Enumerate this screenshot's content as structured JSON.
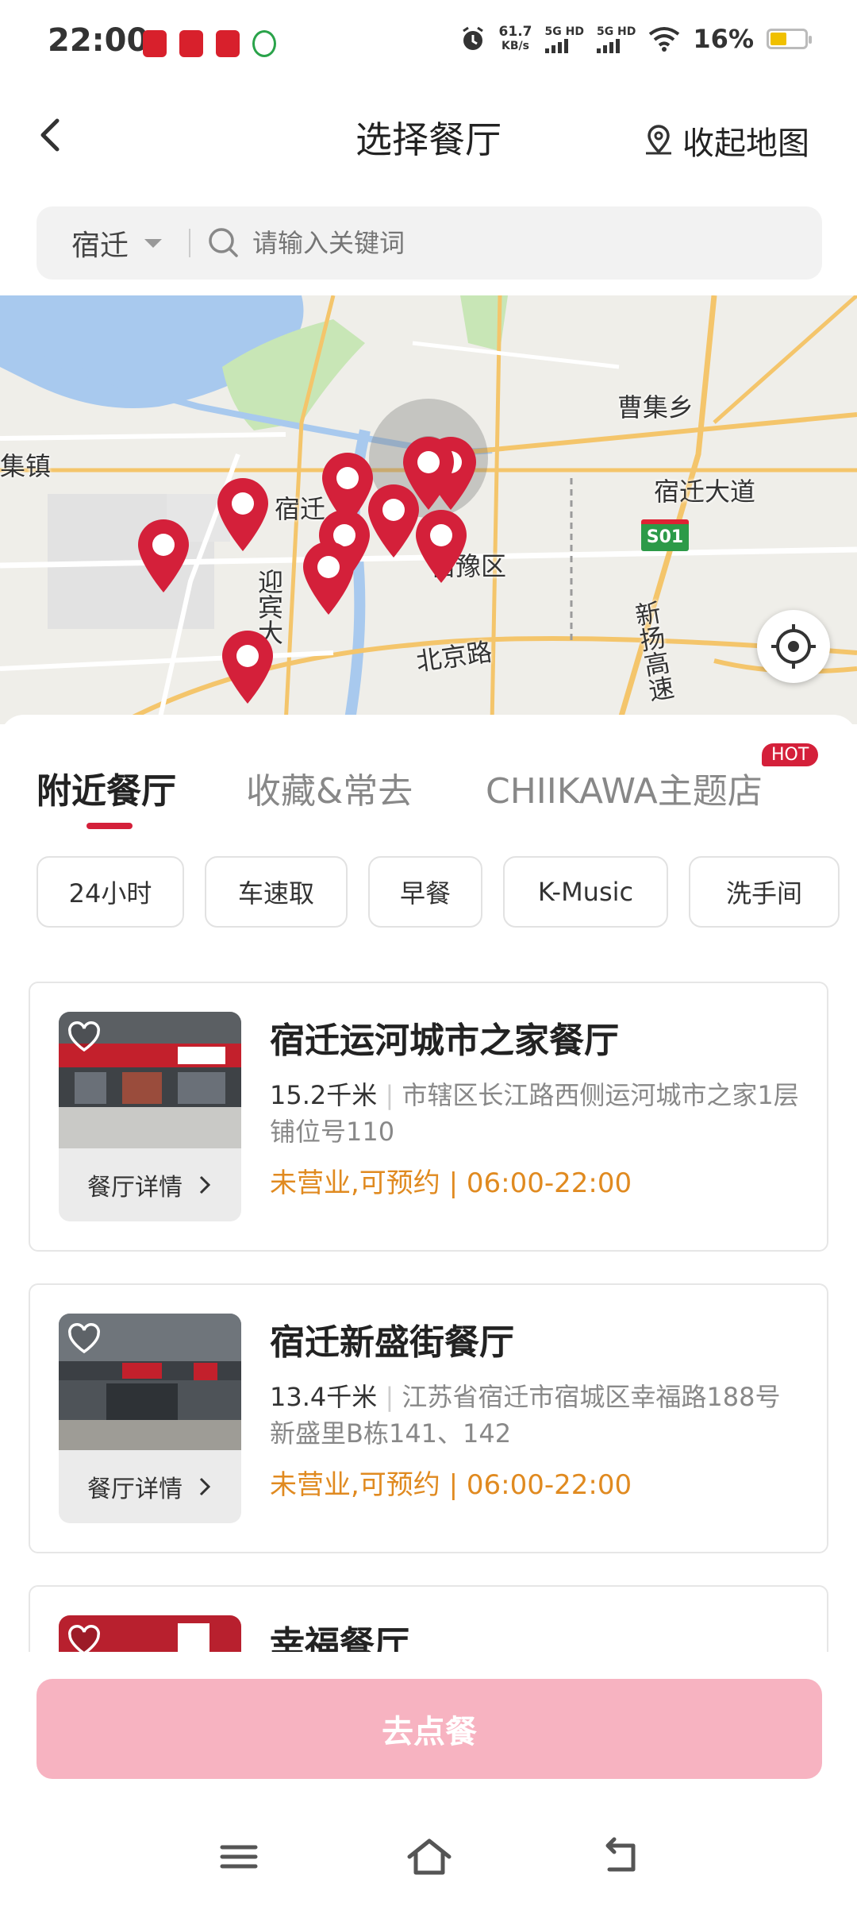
{
  "status_bar": {
    "time": "22:00",
    "net_speed": "61.7",
    "net_unit": "KB/s",
    "sig1": "5G HD",
    "sig2": "5G HD",
    "battery": "16%"
  },
  "header": {
    "title": "选择餐厅",
    "collapse_map": "收起地图"
  },
  "search": {
    "city": "宿迁",
    "placeholder": "请输入关键词"
  },
  "map": {
    "labels": {
      "caoji": "曹集乡",
      "left_town": "集镇",
      "suqian": "宿迁",
      "suqian_avenue": "宿迁大道",
      "suyu": "宿豫区",
      "yingbin": "迎宾大",
      "beijing_rd": "北京路",
      "xinyang": "新扬高速",
      "s01": "S01"
    },
    "pin_color": "#d4203a"
  },
  "tabs": {
    "nearby": "附近餐厅",
    "favorites": "收藏&常去",
    "chiikawa": "CHIIKAWA主题店",
    "hot": "HOT"
  },
  "filters": [
    "24小时",
    "车速取",
    "早餐",
    "K-Music",
    "洗手间"
  ],
  "restaurants": [
    {
      "name": "宿迁运河城市之家餐厅",
      "distance": "15.2千米",
      "address": "市辖区长江路西侧运河城市之家1层铺位号110",
      "status": "未营业,可预约 | 06:00-22:00",
      "detail": "餐厅详情"
    },
    {
      "name": "宿迁新盛街餐厅",
      "distance": "13.4千米",
      "address": "江苏省宿迁市宿城区幸福路188号新盛里B栋141、142",
      "status": "未营业,可预约 | 06:00-22:00",
      "detail": "餐厅详情"
    },
    {
      "name": "幸福餐厅"
    }
  ],
  "order_button": "去点餐",
  "colors": {
    "accent": "#d4203a",
    "status_orange": "#e08a20",
    "order_btn": "#f7b3c1"
  }
}
